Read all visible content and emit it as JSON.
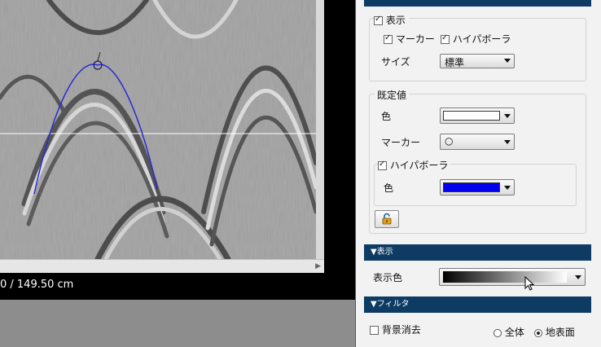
{
  "viewer": {
    "coordinate_readout": "0 / 149.50 cm"
  },
  "marker_panel": {
    "display_label": "表示",
    "display_checked": true,
    "marker_label": "マーカー",
    "marker_checked": true,
    "hyperbola_label": "ハイパボーラ",
    "hyperbola_checked": true,
    "size_label": "サイズ",
    "size_value": "標準"
  },
  "defaults": {
    "group_label": "既定値",
    "color_label": "色",
    "color_value": "#ffffff",
    "marker_label": "マーカー",
    "marker_value": "○",
    "hyperbola_label": "ハイパボーラ",
    "hyperbola_checked": true,
    "hyperbola_color_label": "色",
    "hyperbola_color_value": "#0000ee",
    "lock_icon": "unlock-icon"
  },
  "display_section": {
    "header": "▼表示",
    "color_label": "表示色",
    "gradient": [
      "#000000",
      "#ffffff"
    ]
  },
  "filter_section": {
    "header": "▼フィルタ",
    "background_removal_label": "背景消去",
    "background_removal_checked": false,
    "radio_all_label": "全体",
    "radio_ground_label": "地表面",
    "selected": "地表面"
  },
  "colors": {
    "header_bg": "#0d3b63",
    "hyperbola_line": "#2a2ad8",
    "crosshair": "#ffffff"
  }
}
